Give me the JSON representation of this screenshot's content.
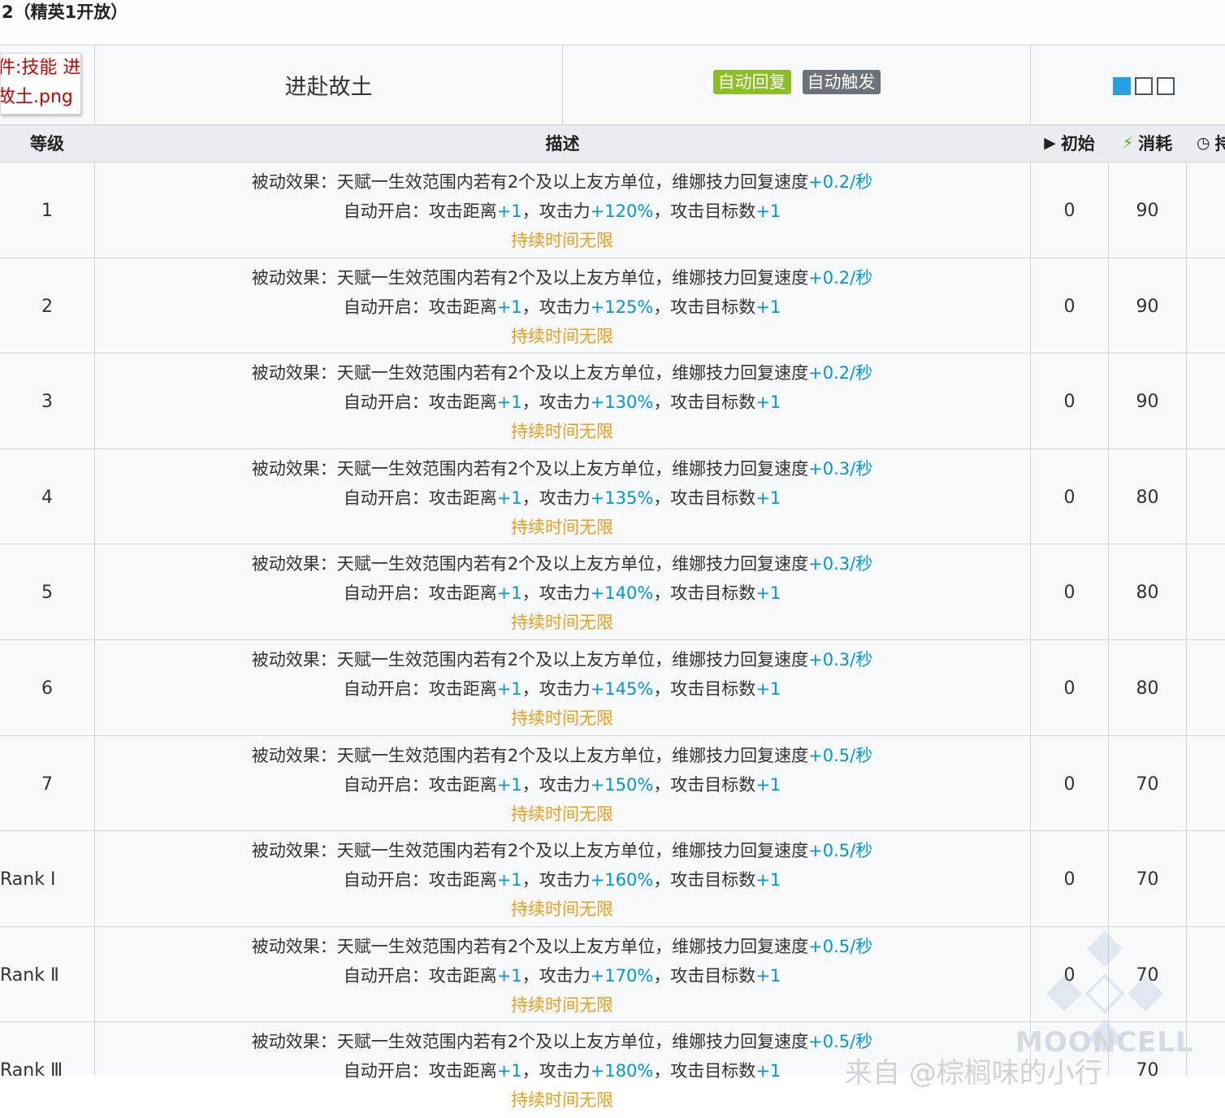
{
  "page_title": "2（精英1开放）",
  "skill": {
    "image_alt": [
      "件:技能 进",
      "故土.png"
    ],
    "name": "进赴故土",
    "tags": [
      "自动回复",
      "自动触发"
    ],
    "colors": {
      "tag_recovery": "#8cbf26",
      "tag_trigger": "#6d7178",
      "highlight": "#0098dc",
      "duration": "#f29d1a"
    }
  },
  "headers": {
    "level": "等级",
    "description": "描述",
    "initial": "初始",
    "initial_icon": "play-icon",
    "cost": "消耗",
    "cost_icon": "lightning-icon",
    "duration": "持",
    "duration_icon": "clock-icon"
  },
  "rows": [
    {
      "level": "1",
      "regen": "+0.2/秒",
      "atk": "+120%",
      "initial": "0",
      "cost": "90"
    },
    {
      "level": "2",
      "regen": "+0.2/秒",
      "atk": "+125%",
      "initial": "0",
      "cost": "90"
    },
    {
      "level": "3",
      "regen": "+0.2/秒",
      "atk": "+130%",
      "initial": "0",
      "cost": "90"
    },
    {
      "level": "4",
      "regen": "+0.3/秒",
      "atk": "+135%",
      "initial": "0",
      "cost": "80"
    },
    {
      "level": "5",
      "regen": "+0.3/秒",
      "atk": "+140%",
      "initial": "0",
      "cost": "80"
    },
    {
      "level": "6",
      "regen": "+0.3/秒",
      "atk": "+145%",
      "initial": "0",
      "cost": "80"
    },
    {
      "level": "7",
      "regen": "+0.5/秒",
      "atk": "+150%",
      "initial": "0",
      "cost": "70"
    },
    {
      "level": "Rank Ⅰ",
      "regen": "+0.5/秒",
      "atk": "+160%",
      "initial": "0",
      "cost": "70"
    },
    {
      "level": "Rank Ⅱ",
      "regen": "+0.5/秒",
      "atk": "+170%",
      "initial": "0",
      "cost": "70"
    },
    {
      "level": "Rank Ⅲ",
      "regen": "+0.5/秒",
      "atk": "+180%",
      "initial": "",
      "cost": "70"
    }
  ],
  "text": {
    "passive_prefix": "被动效果：天赋一生效范围内若有2个及以上友方单位，维娜技力回复速度",
    "auto_prefix": "自动开启：攻击距离",
    "range_plus": "+1",
    "atk_prefix": "，攻击力",
    "target_prefix": "，攻击目标数",
    "target_plus": "+1",
    "duration": "持续时间无限"
  },
  "watermark": {
    "brand": "MOONCELL",
    "credit": "来自 @棕榈味的小行"
  }
}
